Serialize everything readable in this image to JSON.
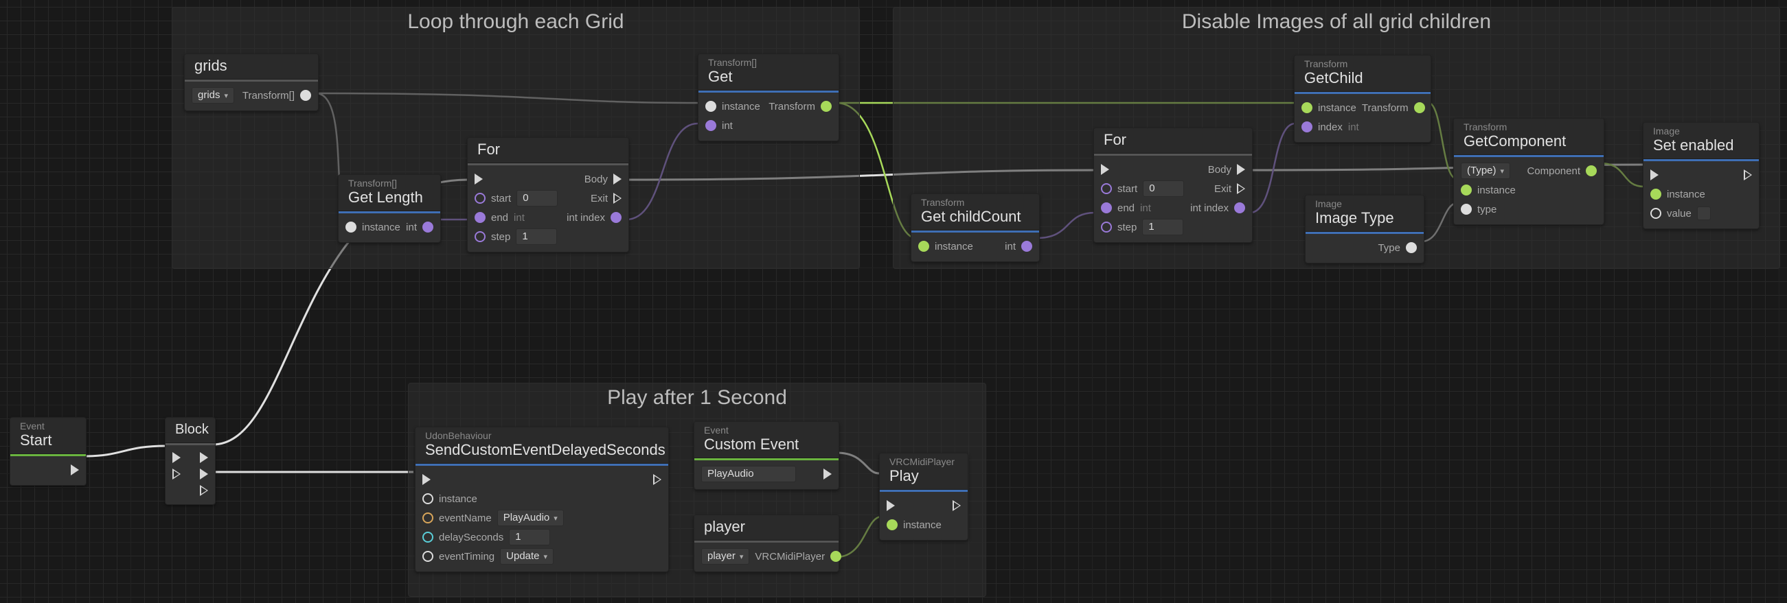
{
  "groups": {
    "loop": {
      "title": "Loop through each Grid"
    },
    "disable": {
      "title": "Disable Images of all grid children"
    },
    "play": {
      "title": "Play after 1 Second"
    }
  },
  "nodes": {
    "start": {
      "subtype": "Event",
      "title": "Start"
    },
    "block": {
      "title": "Block"
    },
    "grids": {
      "title": "grids",
      "dropdown": "grids",
      "type_lbl": "Transform[]"
    },
    "getlength": {
      "subtype": "Transform[]",
      "title": "Get Length",
      "in_instance": "instance",
      "out_int": "int"
    },
    "for1": {
      "title": "For",
      "start_lbl": "start",
      "start_val": "0",
      "end_lbl": "end",
      "end_hint": "int",
      "step_lbl": "step",
      "step_val": "1",
      "body_lbl": "Body",
      "exit_lbl": "Exit",
      "intidx_lbl": "int index"
    },
    "get": {
      "subtype": "Transform[]",
      "title": "Get",
      "in_instance": "instance",
      "in_int": "int",
      "out_transform": "Transform"
    },
    "getchildcount": {
      "subtype": "Transform",
      "title": "Get childCount",
      "in_instance": "instance",
      "out_int": "int"
    },
    "for2": {
      "title": "For",
      "start_lbl": "start",
      "start_val": "0",
      "end_lbl": "end",
      "end_hint": "int",
      "step_lbl": "step",
      "step_val": "1",
      "body_lbl": "Body",
      "exit_lbl": "Exit",
      "intidx_lbl": "int index"
    },
    "getchild": {
      "subtype": "Transform",
      "title": "GetChild",
      "in_instance": "instance",
      "in_index": "index",
      "in_index_hint": "int",
      "out_transform": "Transform"
    },
    "imagetype": {
      "subtype": "Image",
      "title": "Image Type",
      "out_type": "Type"
    },
    "getcomponent": {
      "subtype": "Transform",
      "title": "GetComponent",
      "type_dd": "(Type)",
      "in_instance": "instance",
      "in_type": "type",
      "out_component": "Component"
    },
    "setenabled": {
      "subtype": "Image",
      "title": "Set enabled",
      "in_instance": "instance",
      "in_value": "value"
    },
    "sendcustom": {
      "subtype": "UdonBehaviour",
      "title": "SendCustomEventDelayedSeconds",
      "in_instance": "instance",
      "in_eventname": "eventName",
      "eventname_val": "PlayAudio",
      "in_delay": "delaySeconds",
      "delay_val": "1",
      "in_timing": "eventTiming",
      "timing_val": "Update"
    },
    "customevent": {
      "subtype": "Event",
      "title": "Custom Event",
      "name_val": "PlayAudio"
    },
    "player": {
      "title": "player",
      "dropdown": "player",
      "type_lbl": "VRCMidiPlayer"
    },
    "play": {
      "subtype": "VRCMidiPlayer",
      "title": "Play",
      "in_instance": "instance"
    }
  }
}
